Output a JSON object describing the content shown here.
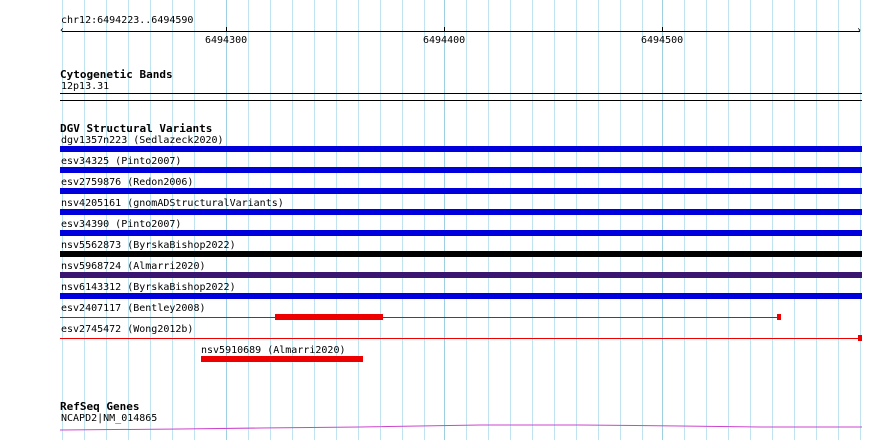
{
  "coordinates": {
    "label": "chr12:6494223..6494590",
    "ticks": [
      "6494300",
      "6494400",
      "6494500"
    ]
  },
  "cytogenetic_bands": {
    "title": "Cytogenetic Bands",
    "band": "12p13.31"
  },
  "dgv": {
    "title": "DGV Structural Variants",
    "features": [
      {
        "label": "dgv1357n223 (Sedlazeck2020)",
        "color": "#0000dd"
      },
      {
        "label": "esv34325 (Pinto2007)",
        "color": "#0000dd"
      },
      {
        "label": "esv2759876 (Redon2006)",
        "color": "#0000dd"
      },
      {
        "label": "nsv4205161 (gnomADStructuralVariants)",
        "color": "#0000dd"
      },
      {
        "label": "esv34390 (Pinto2007)",
        "color": "#0000dd"
      },
      {
        "label": "nsv5562873 (ByrskaBishop2022)",
        "color": "#000000"
      },
      {
        "label": "nsv5968724 (Almarri2020)",
        "color": "#3a1670"
      },
      {
        "label": "nsv6143312 (ByrskaBishop2022)",
        "color": "#0000dd"
      },
      {
        "label": "esv2407117 (Bentley2008)",
        "color": "#ee0000"
      },
      {
        "label": "esv2745472 (Wong2012b)",
        "color": "#ee0000"
      },
      {
        "label": "nsv5910689 (Almarri2020)",
        "color": "#ee0000"
      }
    ]
  },
  "refseq": {
    "title": "RefSeq Genes",
    "gene": "NCAPD2|NM_014865",
    "color": "#cc44cc"
  }
}
